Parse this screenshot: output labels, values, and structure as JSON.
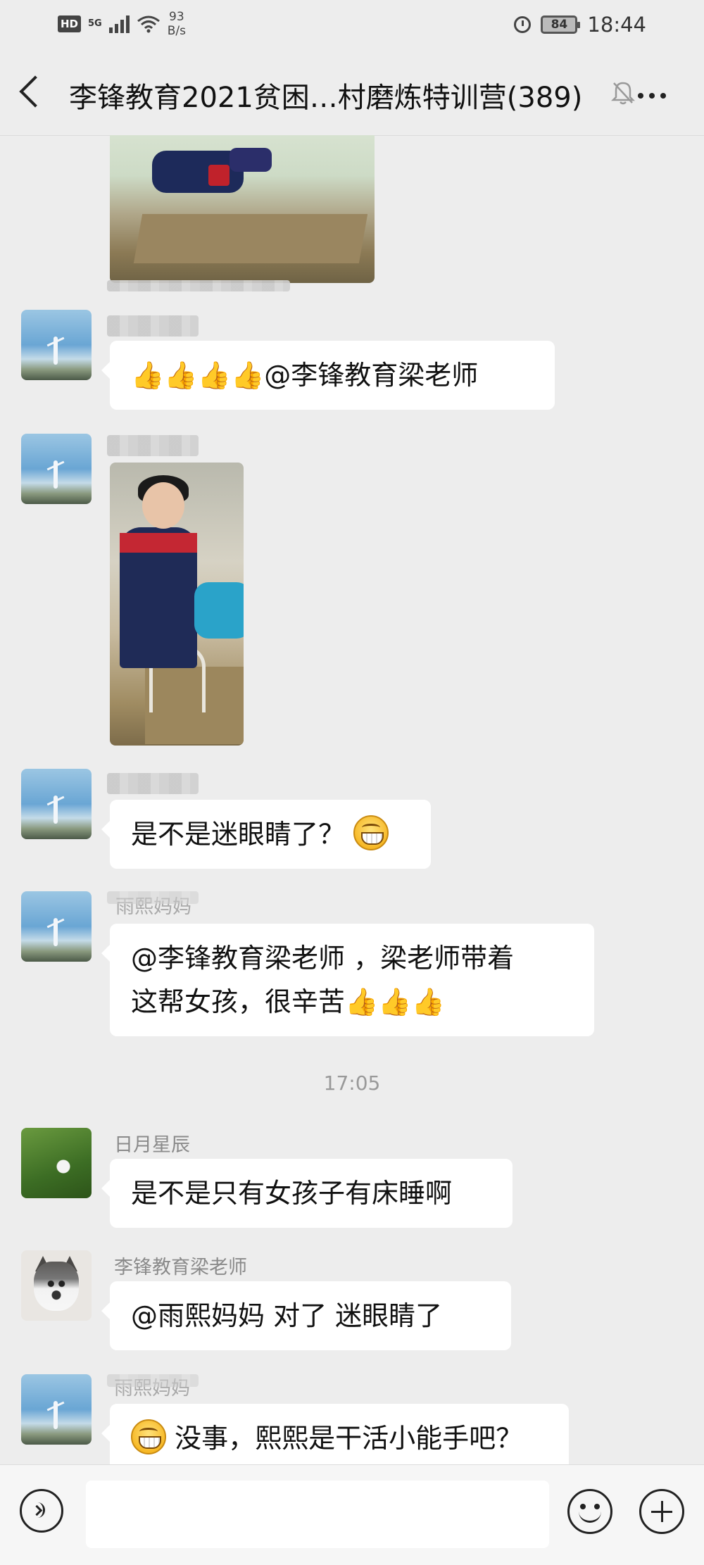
{
  "status_bar": {
    "hd": "HD",
    "network": "5G",
    "speed_value": "93",
    "speed_unit": "B/s",
    "battery": "84",
    "time": "18:44"
  },
  "header": {
    "title": "李锋教育2021贫困…村磨炼特训营(389)"
  },
  "messages": [
    {
      "type": "image",
      "sender": "",
      "description": "girls making beds"
    },
    {
      "type": "text",
      "sender": "",
      "text": "👍👍👍👍@李锋教育梁老师"
    },
    {
      "type": "image",
      "sender": "",
      "description": "girl wiping eyes"
    },
    {
      "type": "text",
      "sender": "",
      "text": "是不是迷眼睛了？"
    },
    {
      "type": "text",
      "sender": "雨熙妈妈",
      "line1": "@李锋教育梁老师 ，梁老师带着",
      "line2": "这帮女孩，很辛苦👍👍👍"
    },
    {
      "type": "text",
      "sender": "日月星辰",
      "text": "是不是只有女孩子有床睡啊"
    },
    {
      "type": "text",
      "sender": "李锋教育梁老师",
      "text": "@雨熙妈妈  对了  迷眼睛了"
    },
    {
      "type": "text",
      "sender": "雨熙妈妈",
      "text": "没事，熙熙是干活小能手吧？"
    }
  ],
  "timestamp": "17:05",
  "input": {
    "value": "",
    "placeholder": ""
  },
  "icons": {
    "back": "back-icon",
    "mute": "bell-mute-icon",
    "more": "more-icon",
    "voice": "voice-icon",
    "emoji": "emoji-icon",
    "plus": "plus-icon"
  }
}
